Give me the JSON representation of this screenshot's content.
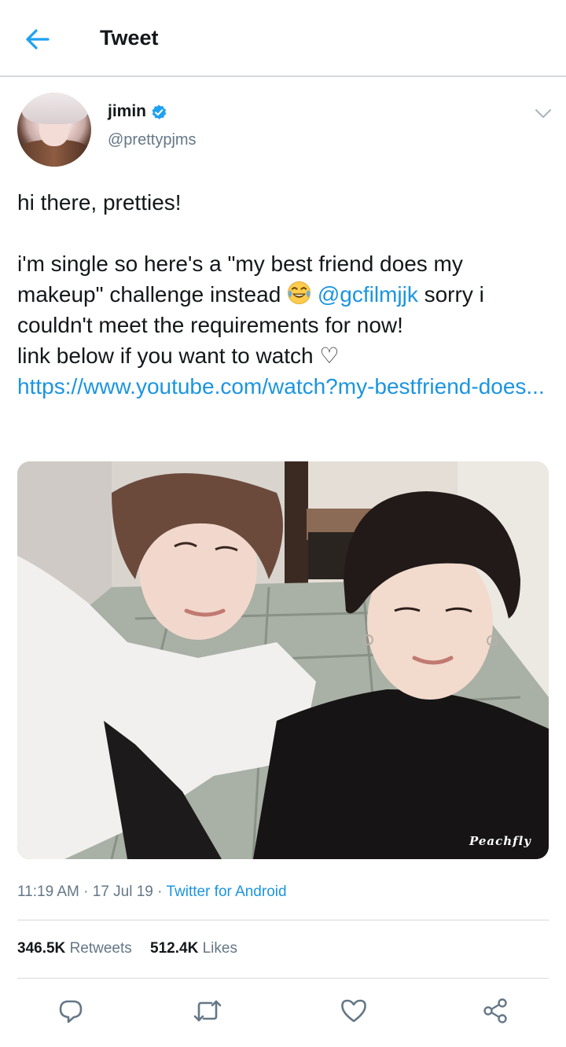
{
  "header": {
    "title": "Tweet",
    "back_icon": "arrow-left-icon",
    "accent_color": "#1da1f2"
  },
  "tweet": {
    "author": {
      "display_name": "jimin",
      "handle": "@prettypjms",
      "verified": true
    },
    "text": {
      "line1": "hi there, pretties!",
      "part1": "i'm single so here's a \"my best friend does my makeup\" challenge instead ",
      "emoji": "face-with-tears-of-joy",
      "mention": "@gcfilmjjk",
      "part2": " sorry i couldn't meet the requirements for now!",
      "part3": "link below if you want to watch ♡",
      "link": "https://www.youtube.com/watch?my-bestfriend-does..."
    },
    "media": {
      "watermark": "Peachfly"
    },
    "time": "11:19 AM",
    "date": "17 Jul 19",
    "separator": " · ",
    "source": "Twitter for Android",
    "stats": {
      "retweets_count": "346.5K",
      "retweets_label": "Retweets",
      "likes_count": "512.4K",
      "likes_label": "Likes"
    }
  },
  "colors": {
    "link": "#1b95e0",
    "muted": "#657786",
    "text": "#14171a",
    "divider": "#d6d9db"
  }
}
